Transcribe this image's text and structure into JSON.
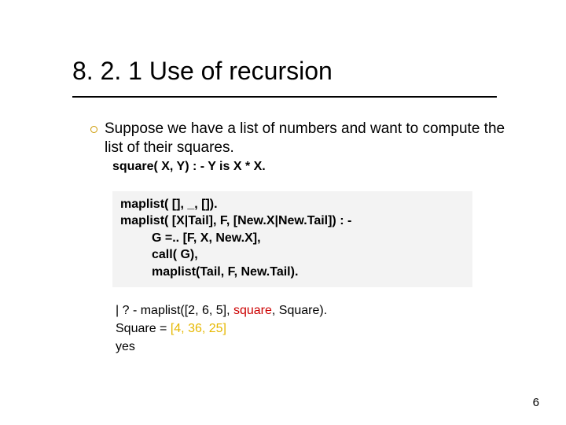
{
  "title": "8. 2. 1 Use of recursion",
  "bullet": {
    "text": "Suppose we have a list of numbers and want to compute the list of their squares."
  },
  "code1": "square( X, Y) : - Y is X * X.",
  "codebox": {
    "l1": "maplist( [], _, []).",
    "l2": "maplist( [X|Tail], F, [New.X|New.Tail]) : -",
    "l3": "G =.. [F, X, New.X],",
    "l4": "call( G),",
    "l5": "maplist(Tail, F, New.Tail)."
  },
  "result": {
    "r1a": "| ? - maplist([2, 6, 5], ",
    "r1b": "square",
    "r1c": ", Square).",
    "r2a": "Square = ",
    "r2b": "[4, 36, 25]",
    "r3": "yes"
  },
  "pagenum": "6"
}
